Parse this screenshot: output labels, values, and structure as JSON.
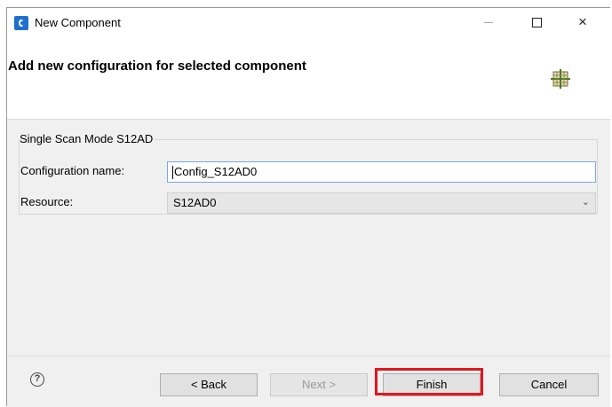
{
  "window": {
    "title": "New Component",
    "close_glyph": "×"
  },
  "banner": {
    "title": "Add new configuration for selected component",
    "icon": "component-grid-icon"
  },
  "group": {
    "title": "Single Scan Mode S12AD",
    "configuration_label": "Configuration name:",
    "configuration_value": "Config_S12AD0",
    "resource_label": "Resource:",
    "resource_value": "S12AD0",
    "resource_arrow": "⌄"
  },
  "footer": {
    "help_glyph": "?",
    "back_label": "< Back",
    "next_label": "Next >",
    "finish_label": "Finish",
    "cancel_label": "Cancel"
  },
  "colors": {
    "highlight": "#e0171f",
    "focus_border": "#7aa7df"
  }
}
